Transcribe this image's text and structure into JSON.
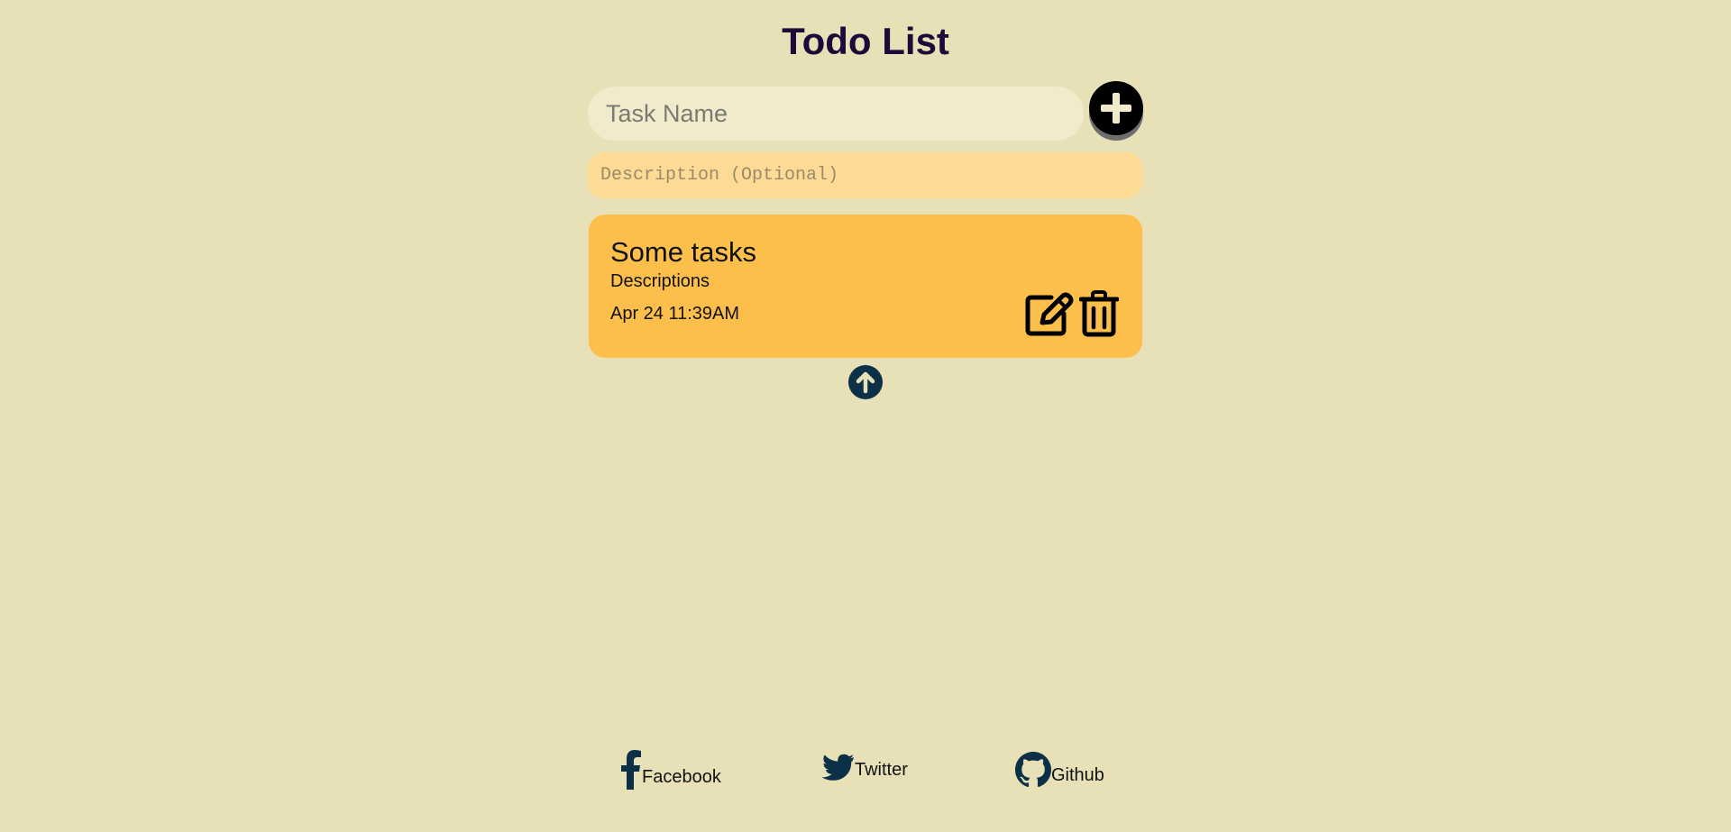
{
  "header": {
    "title": "Todo List"
  },
  "form": {
    "task_placeholder": "Task Name",
    "task_value": "",
    "description_placeholder": "Description (Optional)",
    "description_value": "",
    "add_icon": "plus-circle-icon"
  },
  "tasks": [
    {
      "title": "Some tasks",
      "description": "Descriptions",
      "date": "Apr 24 11:39AM",
      "edit_icon": "edit-icon",
      "delete_icon": "trash-icon"
    }
  ],
  "controls": {
    "scroll_up_icon": "arrow-up-circle-icon"
  },
  "footer": {
    "links": [
      {
        "label": "Facebook",
        "icon": "facebook-icon"
      },
      {
        "label": "Twitter",
        "icon": "twitter-icon"
      },
      {
        "label": "Github",
        "icon": "github-icon"
      }
    ]
  },
  "colors": {
    "background": "#e8e1b8",
    "title": "#1c0b3a",
    "task_input_bg": "#f1ebcb",
    "description_bg": "#fddb95",
    "card_bg": "#fdbf4c",
    "icon_dark": "#0b3048"
  }
}
